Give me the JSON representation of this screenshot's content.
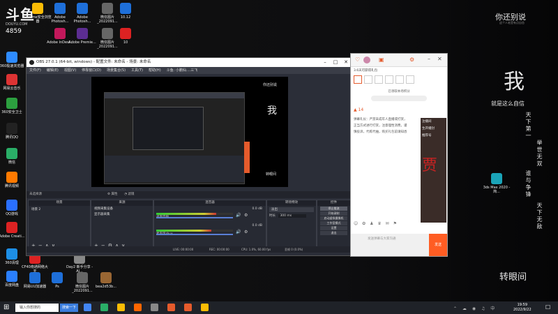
{
  "desktop": {
    "brand": "斗鱼",
    "brand_sub": "DOUYU.COM",
    "room_id": "4859",
    "icons_left": [
      {
        "label": "360极速浏览器",
        "color": "#2e8bff"
      },
      {
        "label": "网易云音乐",
        "color": "#d33"
      },
      {
        "label": "360安全卫士",
        "color": "#2c9f3f"
      },
      {
        "label": "腾讯QQ",
        "color": "#222"
      },
      {
        "label": "微信",
        "color": "#2aae67"
      },
      {
        "label": "腾讯视频",
        "color": "#ff7a00"
      },
      {
        "label": "QQ游戏",
        "color": "#2a6fff"
      },
      {
        "label": "Adobe Creati...",
        "color": "#d22"
      },
      {
        "label": "360清理",
        "color": "#1d8fe6"
      },
      {
        "label": "百度网盘",
        "color": "#2a7fff"
      }
    ],
    "icons_row1": [
      {
        "label": "Chrome安全浏览器",
        "color": "#fbbc05"
      },
      {
        "label": "Adobe Photosh...",
        "color": "#1e6fd9"
      },
      {
        "label": "Adobe Photosh...",
        "color": "#1e6fd9"
      },
      {
        "label": "微信图片_2022091...",
        "color": "#666"
      },
      {
        "label": "10.12",
        "color": "#1e6fd9"
      }
    ],
    "icons_row2": [
      {
        "label": "Adobe InDesi...",
        "color": "#c2185b"
      },
      {
        "label": "Adobe Premie...",
        "color": "#5c2d91"
      },
      {
        "label": "微信图片_2022091...",
        "color": "#666"
      },
      {
        "label": "10",
        "color": "#d22"
      }
    ],
    "icons_bottom": [
      {
        "label": "CF40南通网络大天",
        "color": "#d22"
      },
      {
        "label": "Day2 新手分享 - Al...",
        "color": "#888"
      },
      {
        "label": "网易UU加速器",
        "color": "#1e6fd9"
      },
      {
        "label": "Ps",
        "color": "#1e6fd9"
      },
      {
        "label": "微信图片_2022091...",
        "color": "#666"
      },
      {
        "label": "bea2d53b...",
        "color": "#996633"
      }
    ],
    "icon_3ds": {
      "label": "3ds Max 2020 - 简...",
      "color": "#1aa4b8"
    },
    "wallpaper_text": {
      "top": "你还别说",
      "top_sub": "这个人老是有点自恋",
      "big_char": "我",
      "tagline": "就是这么自信",
      "col1": "天下第一",
      "col2": "举世无双",
      "col3": "谁与争锋",
      "col4": "天下无敌",
      "bottom": "转眼间"
    }
  },
  "obs": {
    "title": "OBS 27.0.1 (64-bit, windows) - 配置文件: 未命名 - 场景: 未命名",
    "menu": [
      "文件(F)",
      "编辑(E)",
      "视图(V)",
      "停靠窗口(D)",
      "场景集合(S)",
      "工具(T)",
      "帮助(H)",
      "斗鱼: 小鹏仙....三飞"
    ],
    "no_source": "未选择源",
    "props_btn": "属性",
    "filters_btn": "滤镜",
    "panels": {
      "scenes": "场景",
      "sources": "来源",
      "mixer": "混音器",
      "transitions": "转场特效",
      "controls": "控件"
    },
    "scene_item": "场景 2",
    "source_items": [
      "视频采集设备",
      "显示器采集"
    ],
    "mixer": [
      {
        "name": "桌面音频",
        "level": "0.0 dB",
        "fill": 0.78
      },
      {
        "name": "麦克风/Aux",
        "level": "0.0 dB",
        "fill": 0.72
      }
    ],
    "transition": {
      "type": "淡出",
      "duration_label": "时长",
      "duration_value": "300 ms"
    },
    "controls": [
      "停止推流",
      "开始录制",
      "启动虚拟摄像机",
      "工作室模式",
      "设置",
      "退出"
    ],
    "status": {
      "live": "LIVE: 00:00:00",
      "rec": "REC: 00:00:00",
      "cpu": "CPU: 1.0%, 60.00 fps",
      "dropped": "丢帧 0 (0.0%)"
    },
    "preview_wallpaper": {
      "title": "你还别说",
      "char": "我",
      "bottom": "转眼间"
    }
  },
  "douyu": {
    "room_title": "3.6天可获得礼包",
    "gift_label": "已领取本场积分",
    "rank": "14",
    "chat_lines": [
      "弹幕礼仪：严禁未成年人直播或打赏，",
      "正当方式进行打赏，注意理性消费，谨",
      "慎投诉，代练代抽，购买礼包前请知悉"
    ],
    "side_text": [
      "注播间",
      "生开播封",
      "推荐号"
    ],
    "input_placeholder": "发送弹幕与大家沟通",
    "send_btn": "发送",
    "watermark": "贾"
  },
  "taskbar": {
    "search_placeholder": "输入你想搜的",
    "search_button": "搜索一下",
    "time": "19:59",
    "date": "2022/9/22",
    "lang": "中"
  }
}
